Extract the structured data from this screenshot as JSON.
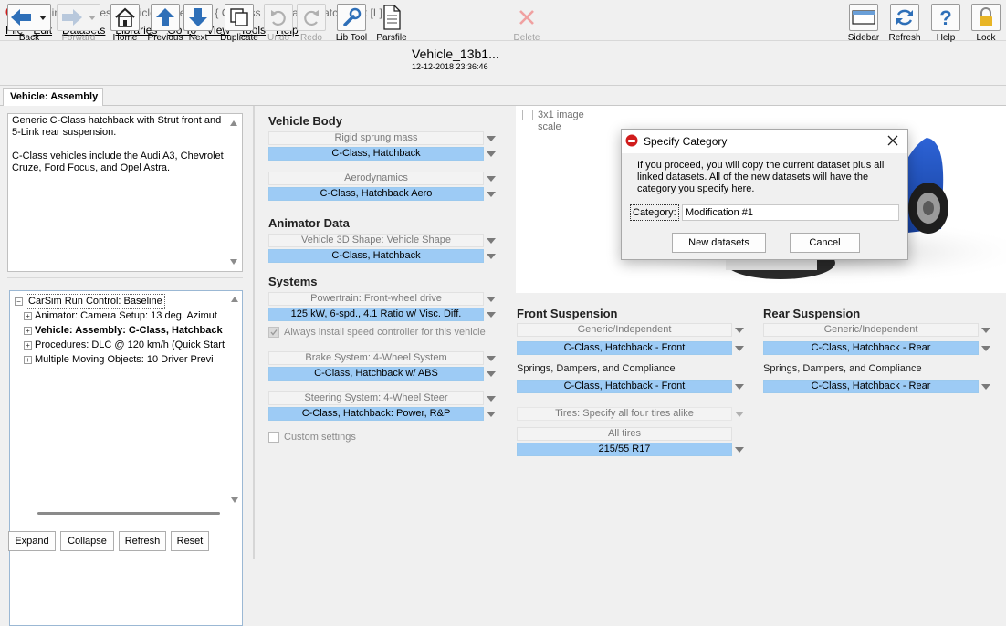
{
  "window": {
    "title": "[CarSim_data_test] Vehicle: Assembly; { C-Class } C-Class, Hatchback [L]"
  },
  "menu": [
    "File",
    "Edit",
    "Datasets",
    "Libraries",
    "Go To",
    "View",
    "Tools",
    "Help"
  ],
  "toolbar": {
    "back": "Back",
    "forward": "Forward",
    "home": "Home",
    "previous": "Previous",
    "next": "Next",
    "duplicate": "Duplicate",
    "undo": "Undo",
    "redo": "Redo",
    "lib_tool": "Lib Tool",
    "parsfile": "Parsfile",
    "dataset_name": "Vehicle_13b1...",
    "dataset_time": "12-12-2018 23:36:46",
    "delete": "Delete",
    "sidebar": "Sidebar",
    "refresh": "Refresh",
    "help": "Help",
    "lock": "Lock"
  },
  "tab": "Vehicle: Assembly",
  "notes": [
    "Generic C-Class hatchback with Strut front and 5-Link rear suspension.",
    "C-Class vehicles include the Audi A3, Chevrolet Cruze, Ford Focus, and Opel Astra."
  ],
  "tree": {
    "root": "CarSim Run Control: Baseline",
    "children": [
      "Animator: Camera Setup: 13 deg. Azimut",
      "Vehicle: Assembly: C-Class, Hatchback",
      "Procedures: DLC @ 120 km/h (Quick Start",
      "Multiple Moving Objects: 10 Driver Previ"
    ]
  },
  "left_buttons": {
    "expand": "Expand",
    "collapse": "Collapse",
    "refresh": "Refresh",
    "reset": "Reset"
  },
  "vehicle_body": {
    "title": "Vehicle Body",
    "sprung_cat": "Rigid sprung mass",
    "sprung_ds": "C-Class, Hatchback",
    "aero_cat": "Aerodynamics",
    "aero_ds": "C-Class, Hatchback Aero"
  },
  "animator": {
    "title": "Animator Data",
    "shape_cat": "Vehicle 3D Shape: Vehicle Shape",
    "shape_ds": "C-Class, Hatchback"
  },
  "systems": {
    "title": "Systems",
    "powertrain_cat": "Powertrain: Front-wheel drive",
    "powertrain_ds": "125 kW, 6-spd., 4.1 Ratio w/ Visc. Diff.",
    "speed_ctrl": "Always install speed controller for this vehicle",
    "brake_cat": "Brake System: 4-Wheel System",
    "brake_ds": "C-Class, Hatchback w/ ABS",
    "steer_cat": "Steering System: 4-Wheel Steer",
    "steer_ds": "C-Class, Hatchback: Power, R&P",
    "custom": "Custom settings"
  },
  "image": {
    "option": "3x1 image scale"
  },
  "front_susp": {
    "title": "Front Suspension",
    "cat": "Generic/Independent",
    "ds": "C-Class, Hatchback - Front",
    "springs_label": "Springs, Dampers, and Compliance",
    "springs_ds": "C-Class, Hatchback - Front"
  },
  "rear_susp": {
    "title": "Rear Suspension",
    "cat": "Generic/Independent",
    "ds": "C-Class, Hatchback - Rear",
    "springs_label": "Springs, Dampers, and Compliance",
    "springs_ds": "C-Class, Hatchback - Rear"
  },
  "tires": {
    "mode": "Tires: Specify all four tires alike",
    "cat": "All tires",
    "ds": "215/55 R17"
  },
  "dialog": {
    "title": "Specify Category",
    "message": "If you proceed, you will copy the current dataset plus all linked datasets. All of the new datasets will have the category you specify here.",
    "category_label": "Category:",
    "category_value": "Modification #1",
    "new_btn": "New datasets",
    "cancel_btn": "Cancel"
  },
  "colors": {
    "selected_dataset": "#9dcbf5",
    "car_body": "#1f4fb5"
  }
}
